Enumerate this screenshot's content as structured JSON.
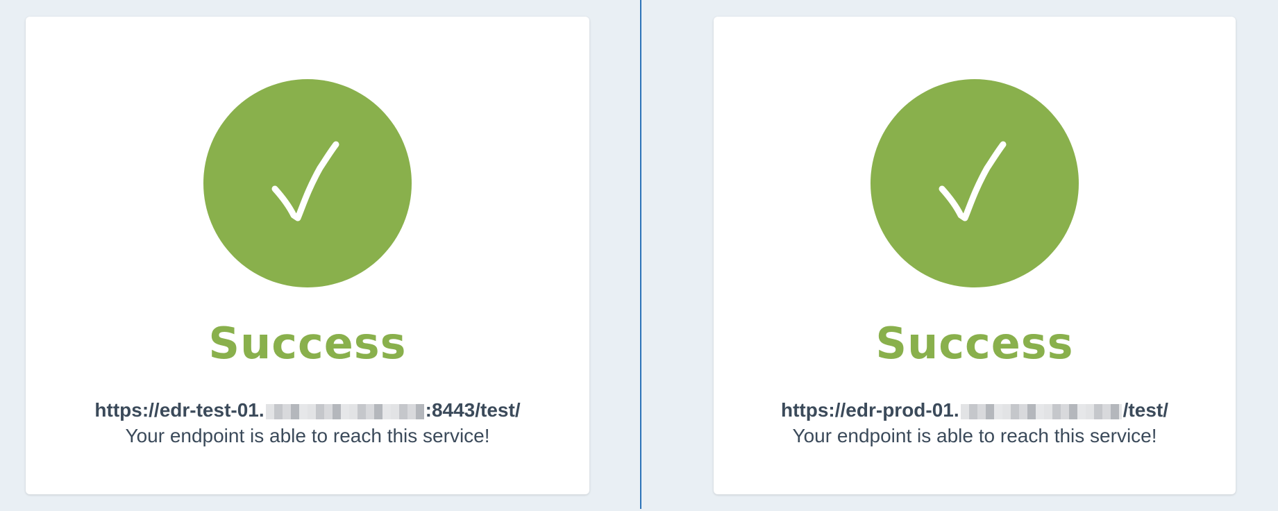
{
  "panels": [
    {
      "title": "Success",
      "url_prefix": "https://edr-test-01.",
      "url_suffix": ":8443/test/",
      "message": "Your endpoint is able to reach this service!"
    },
    {
      "title": "Success",
      "url_prefix": "https://edr-prod-01.",
      "url_suffix": "/test/",
      "message": "Your endpoint is able to reach this service!"
    }
  ],
  "colors": {
    "success_green": "#89b04c",
    "text_dark": "#3b4a5a",
    "background": "#e9eff4",
    "divider": "#2d73b8"
  },
  "icons": {
    "status": "checkmark-icon"
  }
}
